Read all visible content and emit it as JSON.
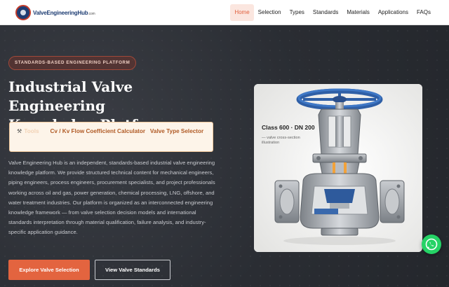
{
  "brand": {
    "name": "ValveEngineeringHub",
    "name_lead": "ValveEngineering",
    "name_hub": "Hub",
    "tld": ".com"
  },
  "nav": {
    "items": [
      {
        "label": "Home",
        "active": true
      },
      {
        "label": "Selection",
        "active": false
      },
      {
        "label": "Types",
        "active": false
      },
      {
        "label": "Standards",
        "active": false
      },
      {
        "label": "Materials",
        "active": false
      },
      {
        "label": "Applications",
        "active": false
      },
      {
        "label": "FAQs",
        "active": false
      }
    ]
  },
  "hero": {
    "tagline": "STANDARDS-BASED ENGINEERING PLATFORM",
    "title_line1": "Industrial Valve Engineering",
    "title_line2": "Knowledge Platform",
    "tools": {
      "icon": "hammer-wrench-icon",
      "faded_label": "Tools",
      "link1": "Cv / Kv Flow Coefficient Calculator",
      "link2": "Valve Type Selector"
    },
    "description": "Valve Engineering Hub is an independent, standards-based industrial valve engineering knowledge platform. We provide structured technical content for mechanical engineers, piping engineers, process engineers, procurement specialists, and project professionals working across oil and gas, power generation, chemical processing, LNG, offshore, and water treatment industries. Our platform is organized as an interconnected engineering knowledge framework — from valve selection decision models and international standards interpretation through material qualification, failure analysis, and industry-specific application guidance.",
    "primary_button": "Explore Valve Selection",
    "secondary_button": "View Valve Standards"
  },
  "image_card": {
    "class_label": "Class 600 · DN 200",
    "caption": "— valve cross-section illustration"
  },
  "colors": {
    "accent": "#e3643f",
    "nav_active_bg": "#fbe6df",
    "hero_bg": "#2b2e34",
    "whatsapp": "#25d366"
  },
  "floating": {
    "icon": "whatsapp-icon"
  }
}
